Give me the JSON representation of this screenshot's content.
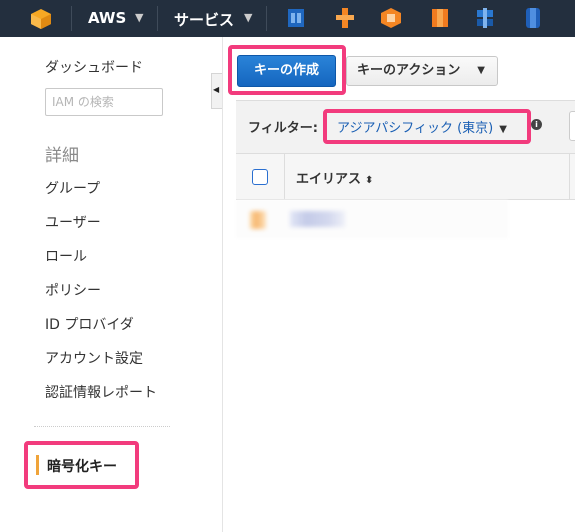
{
  "topbar": {
    "brand_label": "AWS",
    "services_label": "サービス"
  },
  "sidebar": {
    "dashboard": "ダッシュボード",
    "search_placeholder": "IAM の検索",
    "details_heading": "詳細",
    "items": [
      {
        "label": "グループ"
      },
      {
        "label": "ユーザー"
      },
      {
        "label": "ロール"
      },
      {
        "label": "ポリシー"
      },
      {
        "label": "ID プロバイダ"
      },
      {
        "label": "アカウント設定"
      },
      {
        "label": "認証情報レポート"
      }
    ],
    "encryption_keys": "暗号化キー"
  },
  "toolbar": {
    "create_key": "キーの作成",
    "key_actions": "キーのアクション"
  },
  "filter": {
    "label": "フィルター:",
    "region": "アジアパシフィック (東京)"
  },
  "table": {
    "columns": [
      "エイリアス"
    ]
  },
  "colors": {
    "topbar_bg": "#232f3e",
    "highlight": "#f23b7d",
    "primary_button": "#1a6fcf",
    "active_bar": "#f0a43a"
  }
}
